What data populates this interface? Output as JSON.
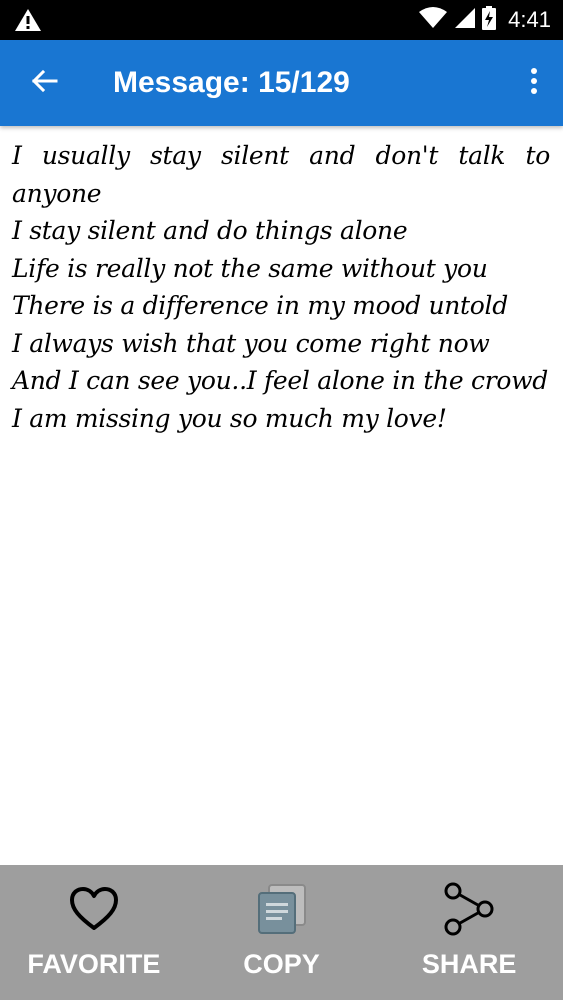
{
  "status_bar": {
    "time": "4:41",
    "icons": [
      "warning-icon",
      "wifi-icon",
      "signal-icon",
      "battery-charging-icon"
    ]
  },
  "app_bar": {
    "title": "Message: 15/129",
    "back_icon": "arrow-back-icon",
    "menu_icon": "more-vert-icon",
    "background_color": "#1976d2"
  },
  "message": {
    "lines": [
      "I usually stay silent and don't talk to anyone",
      "I stay silent and do things alone",
      "Life is really not the same without you",
      "There is a difference in my mood untold",
      "I always wish that you come right now",
      "And I can see you..I feel alone in the crowd",
      "I am missing you so much my love!"
    ]
  },
  "bottom_bar": {
    "background_color": "#9e9e9e",
    "buttons": [
      {
        "label": "FAVORITE",
        "icon": "heart-outline-icon"
      },
      {
        "label": "COPY",
        "icon": "copy-icon"
      },
      {
        "label": "SHARE",
        "icon": "share-icon"
      }
    ]
  }
}
